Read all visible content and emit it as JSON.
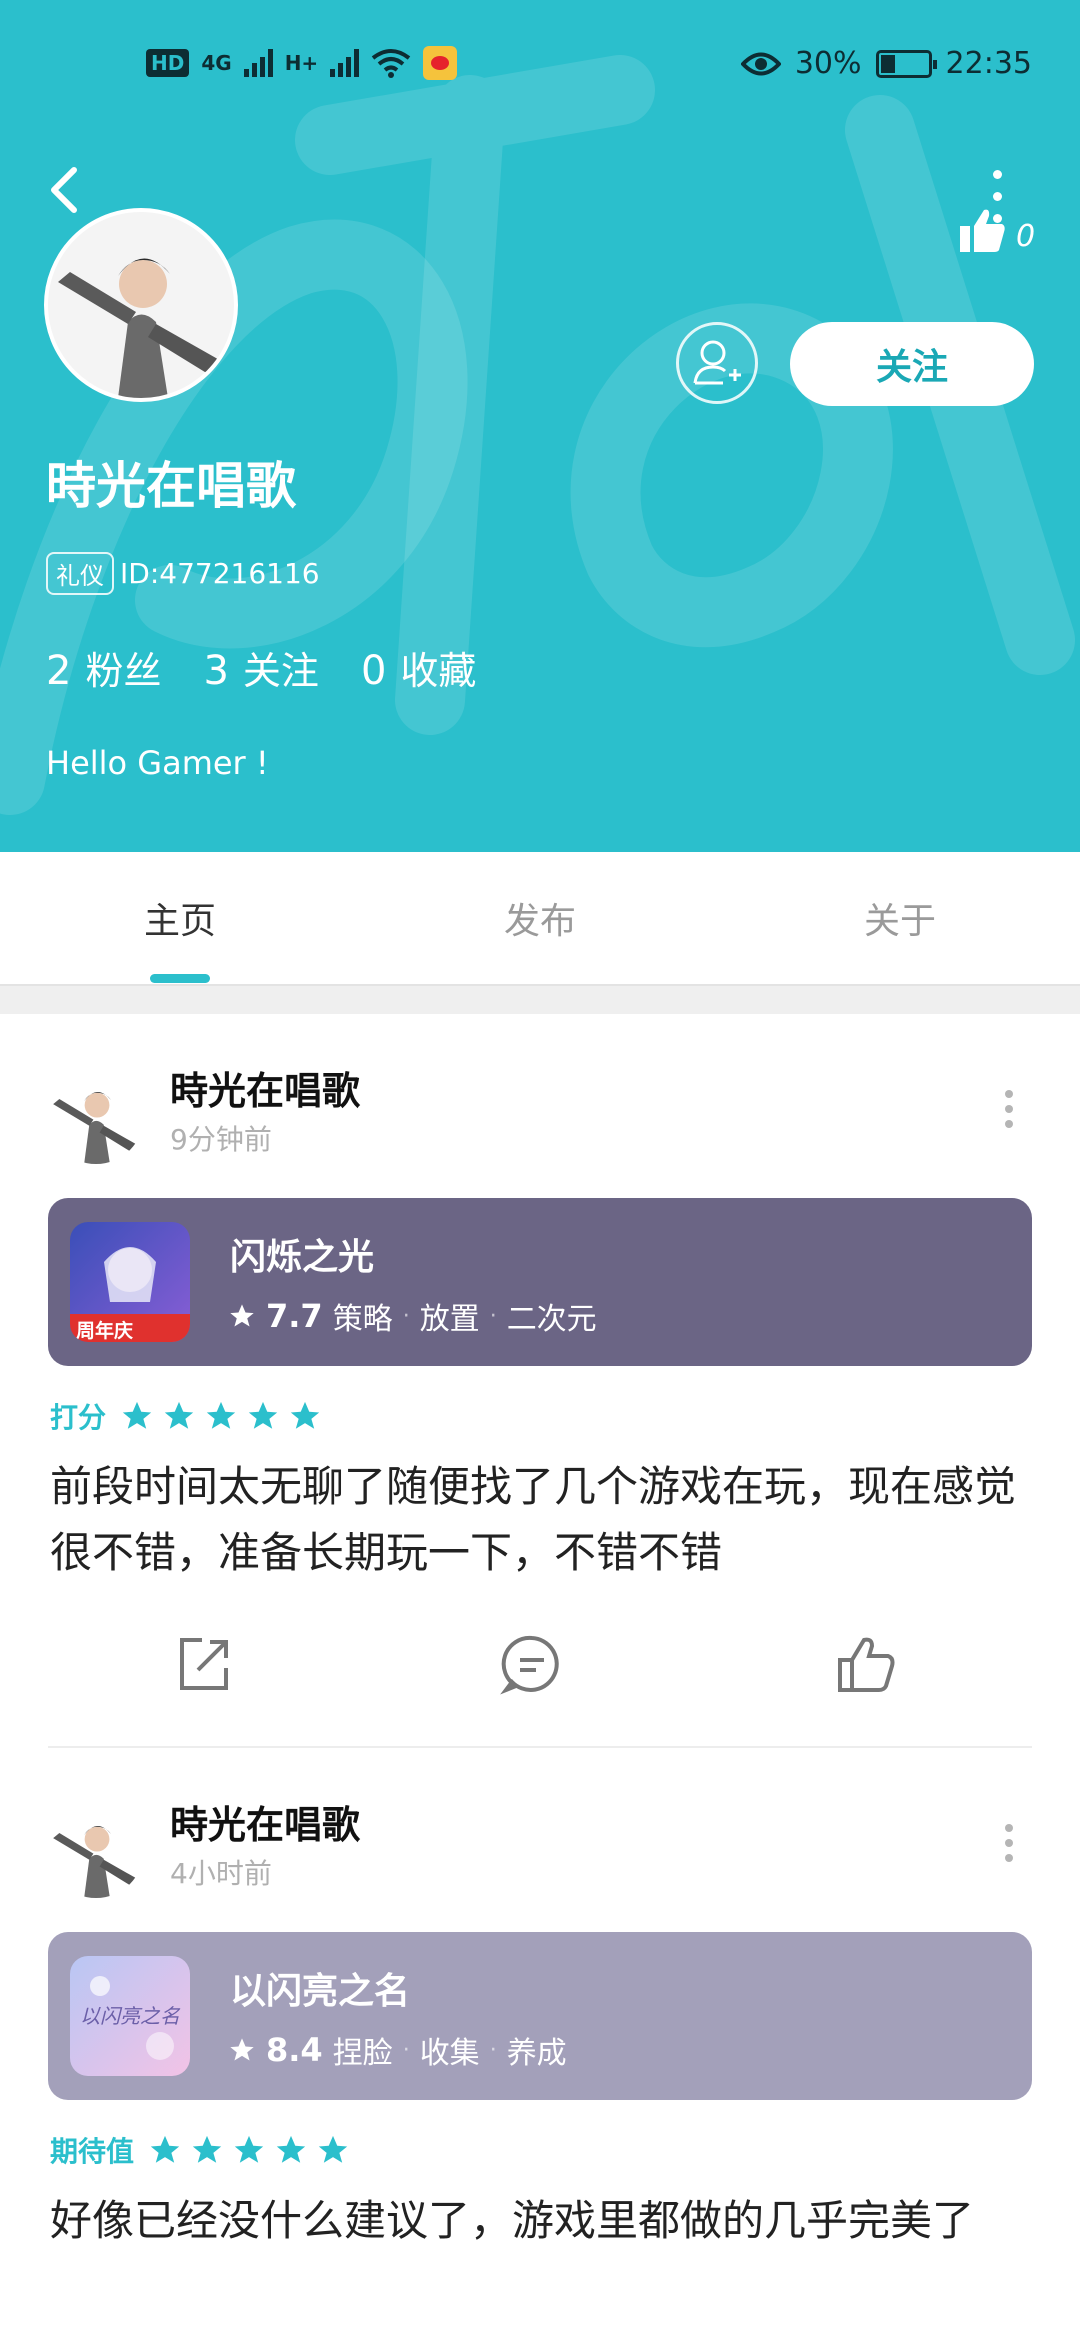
{
  "colors": {
    "accent": "#2bbfcc",
    "card1": "#6b6585",
    "card2": "#a3a0ba",
    "star": "#2bbfcc"
  },
  "status": {
    "left": {
      "hd": "HD",
      "net1": "4G",
      "net2": "H+"
    },
    "right": {
      "battery": "30%",
      "time": "22:35"
    }
  },
  "profile": {
    "name": "時光在唱歌",
    "title_badge": "礼仪",
    "id_text": "ID:477216116",
    "like_count": "0",
    "follow_label": "关注",
    "stats": [
      {
        "value": "2",
        "label": "粉丝"
      },
      {
        "value": "3",
        "label": "关注"
      },
      {
        "value": "0",
        "label": "收藏"
      }
    ],
    "bio": "Hello Gamer !"
  },
  "tabs": [
    {
      "label": "主页"
    },
    {
      "label": "发布"
    },
    {
      "label": "关于"
    }
  ],
  "posts": [
    {
      "author": "時光在唱歌",
      "time": "9分钟前",
      "game": {
        "name": "闪烁之光",
        "score": "7.7",
        "tags": [
          "策略",
          "放置",
          "二次元"
        ],
        "icon_label": "周年庆"
      },
      "rating_label": "打分",
      "rating": 5,
      "text": "前段时间太无聊了随便找了几个游戏在玩，现在感觉很不错，准备长期玩一下，不错不错"
    },
    {
      "author": "時光在唱歌",
      "time": "4小时前",
      "game": {
        "name": "以闪亮之名",
        "score": "8.4",
        "tags": [
          "捏脸",
          "收集",
          "养成"
        ],
        "icon_label": "以闪亮之名"
      },
      "rating_label": "期待值",
      "rating": 5,
      "text": "好像已经没什么建议了，游戏里都做的几乎完美了"
    }
  ]
}
